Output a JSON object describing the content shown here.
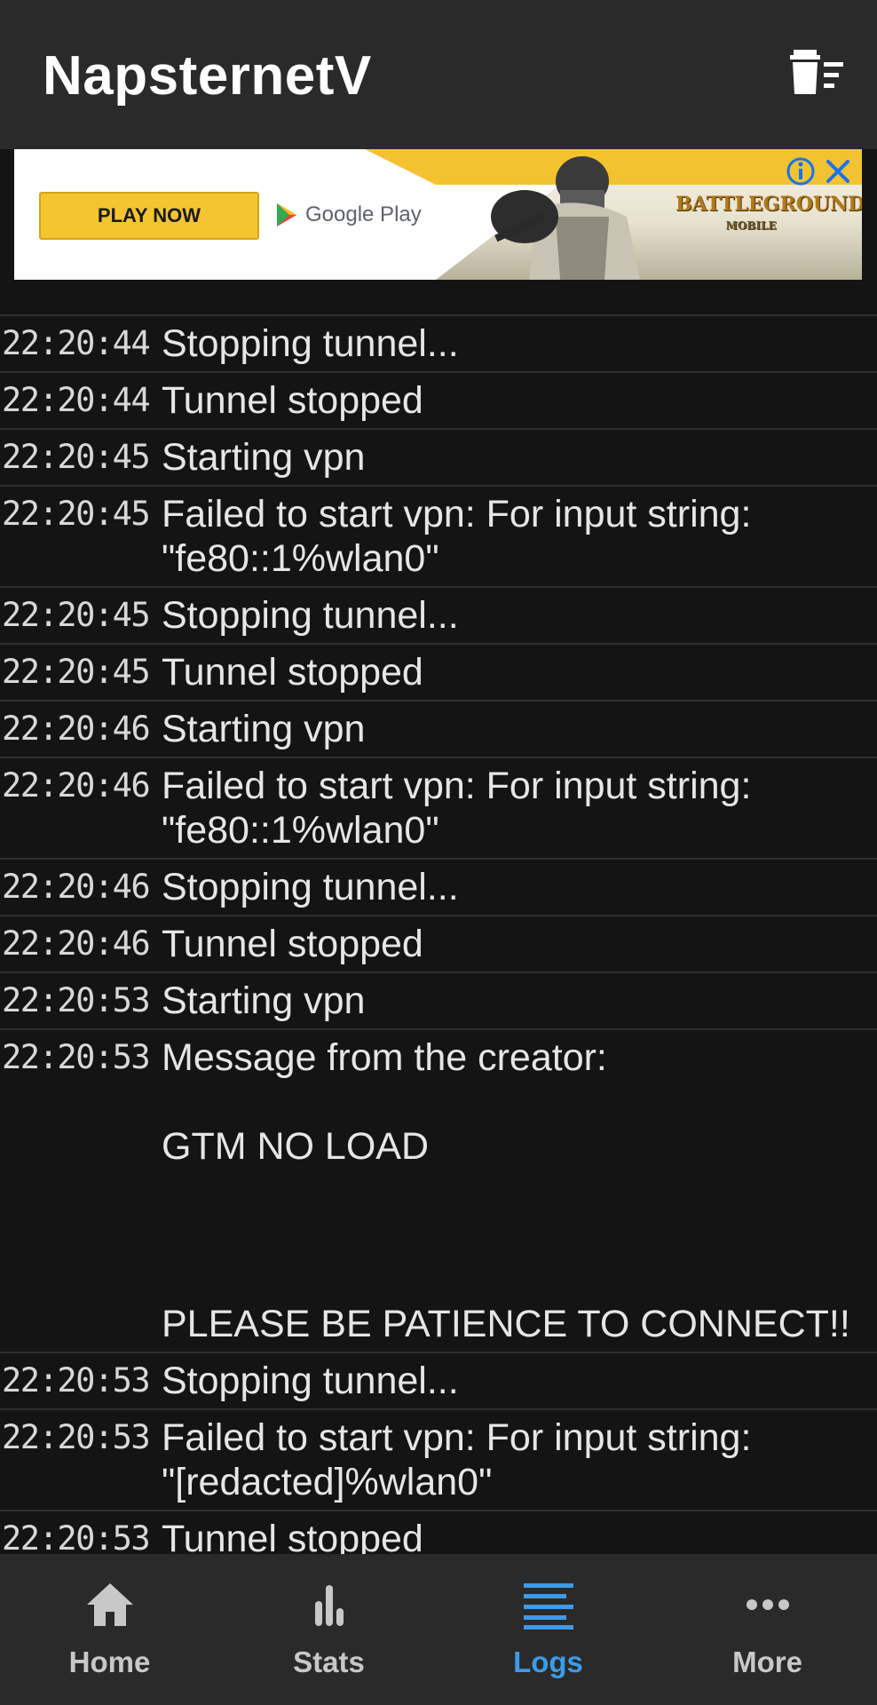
{
  "appbar": {
    "title": "NapsternetV",
    "clear_icon": "clear-logs-icon"
  },
  "ad": {
    "cta": "PLAY NOW",
    "store": "Google Play",
    "brand_line1": "BATTLEGROUNDS",
    "brand_line2": "MOBILE",
    "info_icon": "info-icon",
    "close_icon": "close-icon"
  },
  "logs": {
    "partial_message": "\"fe80::1%wlan0\"",
    "entries": [
      {
        "time": "22:20:44",
        "message": "Stopping tunnel..."
      },
      {
        "time": "22:20:44",
        "message": "Tunnel stopped"
      },
      {
        "time": "22:20:45",
        "message": "Starting vpn"
      },
      {
        "time": "22:20:45",
        "message": "Failed to start vpn: For input string:\n\"fe80::1%wlan0\""
      },
      {
        "time": "22:20:45",
        "message": "Stopping tunnel..."
      },
      {
        "time": "22:20:45",
        "message": "Tunnel stopped"
      },
      {
        "time": "22:20:46",
        "message": "Starting vpn"
      },
      {
        "time": "22:20:46",
        "message": "Failed to start vpn: For input string:\n\"fe80::1%wlan0\""
      },
      {
        "time": "22:20:46",
        "message": "Stopping tunnel..."
      },
      {
        "time": "22:20:46",
        "message": "Tunnel stopped"
      },
      {
        "time": "22:20:53",
        "message": "Starting vpn"
      },
      {
        "time": "22:20:53",
        "message": "Message from the creator:\n\nGTM NO LOAD\n\n\n\nPLEASE BE PATIENCE TO CONNECT!!"
      },
      {
        "time": "22:20:53",
        "message": "Stopping tunnel..."
      },
      {
        "time": "22:20:53",
        "message": "Failed to start vpn: For input string:\n\"[redacted]%wlan0\""
      },
      {
        "time": "22:20:53",
        "message": "Tunnel stopped"
      }
    ]
  },
  "nav": {
    "active_color": "#3d9be9",
    "items": [
      {
        "label": "Home",
        "icon": "home-icon"
      },
      {
        "label": "Stats",
        "icon": "stats-icon"
      },
      {
        "label": "Logs",
        "icon": "logs-icon"
      },
      {
        "label": "More",
        "icon": "more-icon"
      }
    ]
  }
}
